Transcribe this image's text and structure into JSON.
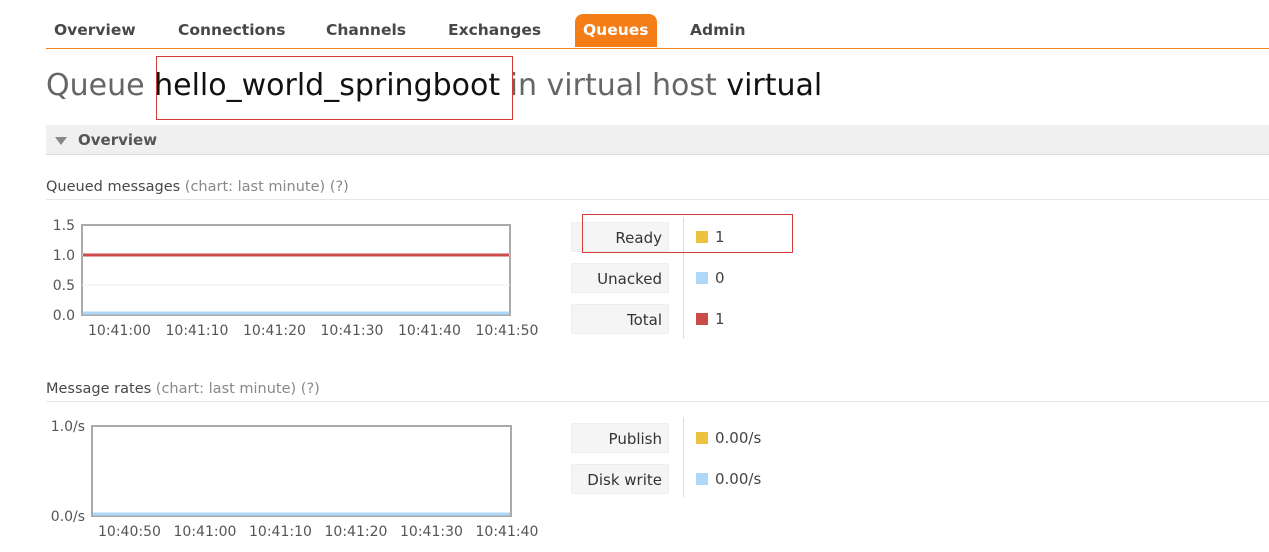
{
  "nav": {
    "tabs": [
      "Overview",
      "Connections",
      "Channels",
      "Exchanges",
      "Queues",
      "Admin"
    ],
    "active": "Queues"
  },
  "title": {
    "prefix": "Queue",
    "queue_name": "hello_world_springboot",
    "middle": "in virtual host",
    "vhost": "virtual"
  },
  "section": {
    "label": "Overview"
  },
  "queued_messages": {
    "heading": "Queued messages",
    "chart_note": "(chart: last minute)",
    "help": "(?)",
    "legend": [
      {
        "label": "Ready",
        "value": "1",
        "color": "#edc240"
      },
      {
        "label": "Unacked",
        "value": "0",
        "color": "#afd8f8"
      },
      {
        "label": "Total",
        "value": "1",
        "color": "#cb4b4b"
      }
    ]
  },
  "message_rates": {
    "heading": "Message rates",
    "chart_note": "(chart: last minute)",
    "help": "(?)",
    "legend": [
      {
        "label": "Publish",
        "value": "0.00/s",
        "color": "#edc240"
      },
      {
        "label": "Disk write",
        "value": "0.00/s",
        "color": "#afd8f8"
      }
    ]
  },
  "chart_data": [
    {
      "type": "line",
      "x": [
        "10:41:00",
        "10:41:10",
        "10:41:20",
        "10:41:30",
        "10:41:40",
        "10:41:50"
      ],
      "yticks": [
        "1.5",
        "1.0",
        "0.5",
        "0.0"
      ],
      "ylim": [
        0,
        1.5
      ],
      "series": [
        {
          "name": "Total",
          "values": [
            1,
            1,
            1,
            1,
            1,
            1
          ],
          "color": "#cb4b4b"
        },
        {
          "name": "Unacked",
          "values": [
            0,
            0,
            0,
            0,
            0,
            0
          ],
          "color": "#afd8f8"
        }
      ]
    },
    {
      "type": "line",
      "x": [
        "10:40:50",
        "10:41:00",
        "10:41:10",
        "10:41:20",
        "10:41:30",
        "10:41:40"
      ],
      "yticks": [
        "1.0/s",
        "0.0/s"
      ],
      "ylim": [
        0,
        1
      ],
      "series": [
        {
          "name": "Disk write",
          "values": [
            0,
            0,
            0,
            0,
            0,
            0
          ],
          "color": "#afd8f8"
        }
      ]
    }
  ]
}
